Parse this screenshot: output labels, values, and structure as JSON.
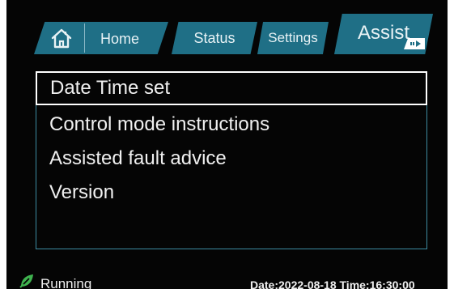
{
  "tabs": {
    "home": {
      "label": "Home",
      "icon": "home-icon"
    },
    "status": {
      "label": "Status"
    },
    "settings": {
      "label": "Settings"
    },
    "assist": {
      "label": "Assist",
      "active": true
    }
  },
  "menu": {
    "items": [
      {
        "label": "Date Time set",
        "selected": true
      },
      {
        "label": "Control mode instructions",
        "selected": false
      },
      {
        "label": "Assisted fault advice",
        "selected": false
      },
      {
        "label": "Version",
        "selected": false
      }
    ]
  },
  "status_bar": {
    "state": "Running",
    "state_icon": "leaf-icon",
    "state_icon_color": "#3fb34f",
    "datetime": "Date:2022-08-18 Time:16:30:00"
  },
  "colors": {
    "background": "#050505",
    "tab": "#1f6f86",
    "panel_border": "#3c8aa0",
    "text": "#f0f0f0"
  }
}
